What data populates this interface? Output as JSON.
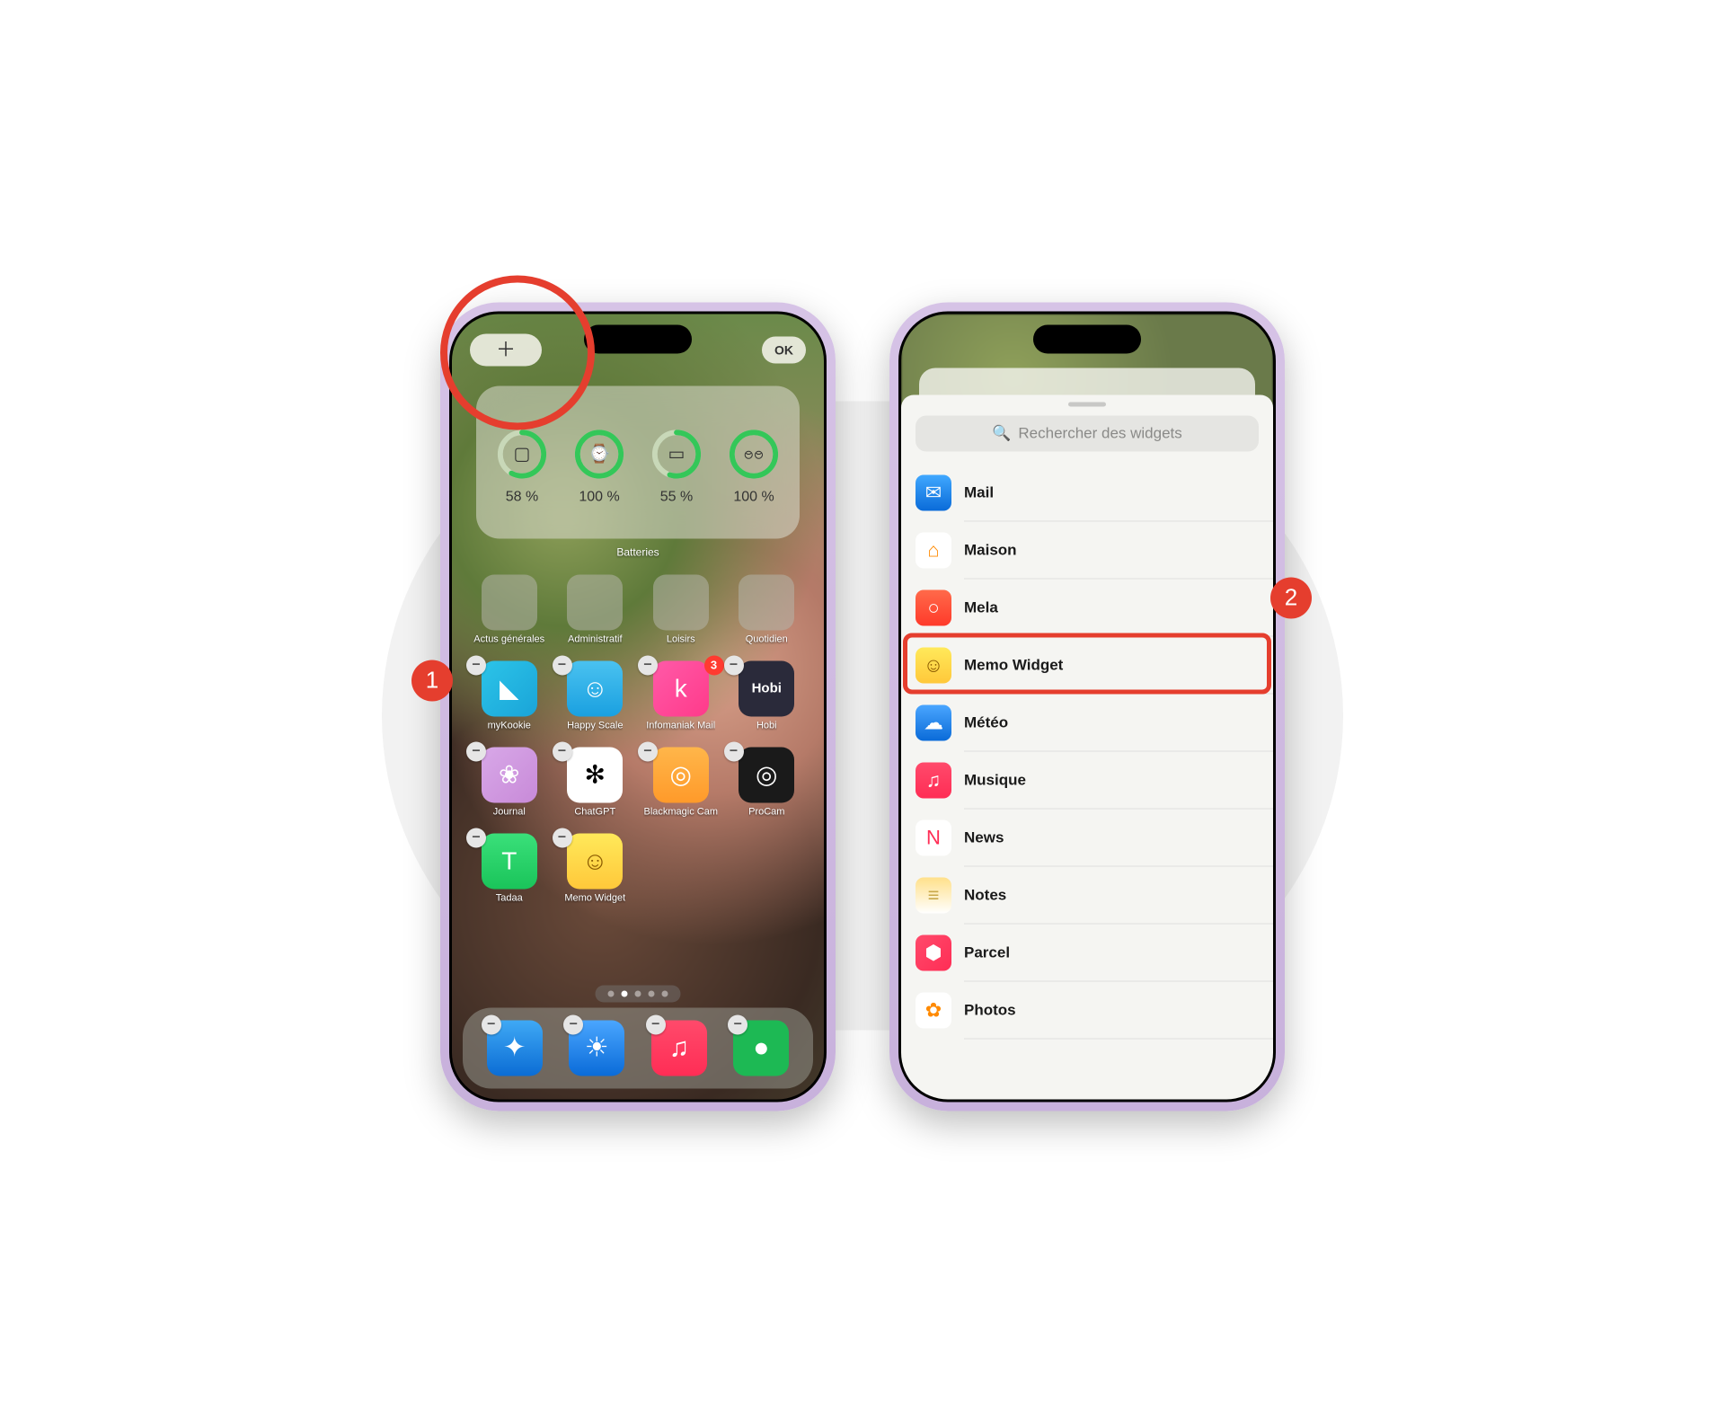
{
  "step_badges": {
    "one": "1",
    "two": "2"
  },
  "left": {
    "add_button": "＋",
    "done_button": "OK",
    "battery_widget": {
      "label": "Batteries",
      "items": [
        {
          "device": "phone",
          "glyph": "▢",
          "pct": "58 %",
          "fill": 0.58
        },
        {
          "device": "watch",
          "glyph": "⌚",
          "pct": "100 %",
          "fill": 1.0
        },
        {
          "device": "case",
          "glyph": "▭",
          "pct": "55 %",
          "fill": 0.55
        },
        {
          "device": "airpods",
          "glyph": "ႎႎ",
          "pct": "100 %",
          "fill": 1.0
        }
      ]
    },
    "folders": [
      {
        "label": "Actus générales"
      },
      {
        "label": "Administratif"
      },
      {
        "label": "Loisirs"
      },
      {
        "label": "Quotidien"
      }
    ],
    "apps": [
      {
        "label": "myKookie",
        "bg": "linear-gradient(135deg,#2cc4e8,#1aa4d8)",
        "glyph": "◣",
        "badge": null
      },
      {
        "label": "Happy Scale",
        "bg": "linear-gradient(180deg,#4ac2f0,#1aa0e0)",
        "glyph": "☺",
        "badge": null
      },
      {
        "label": "Infomaniak Mail",
        "bg": "linear-gradient(135deg,#ff5aa8,#ff3a8a)",
        "glyph": "k",
        "badge": "3"
      },
      {
        "label": "Hobi",
        "bg": "#2a2a3a",
        "glyph": "Hobi",
        "badge": null
      },
      {
        "label": "Journal",
        "bg": "linear-gradient(135deg,#d8a8e8,#c88ad8)",
        "glyph": "❀",
        "badge": null
      },
      {
        "label": "ChatGPT",
        "bg": "#ffffff",
        "glyph": "✻",
        "badge": null,
        "fg": "#000"
      },
      {
        "label": "Blackmagic Cam",
        "bg": "linear-gradient(180deg,#ffb64a,#ff9a2a)",
        "glyph": "◎",
        "badge": null
      },
      {
        "label": "ProCam",
        "bg": "#1a1a1a",
        "glyph": "◎",
        "badge": null
      },
      {
        "label": "Tadaa",
        "bg": "linear-gradient(180deg,#3ae07a,#1ac45a)",
        "glyph": "T",
        "badge": null
      },
      {
        "label": "Memo Widget",
        "bg": "linear-gradient(180deg,#ffe95a,#ffc83a)",
        "glyph": "☺",
        "badge": null,
        "fg": "#8a5a00"
      }
    ],
    "dock": [
      {
        "name": "safari",
        "bg": "ic-safari",
        "glyph": "✦"
      },
      {
        "name": "weather",
        "bg": "ic-weatherdock",
        "glyph": "☀"
      },
      {
        "name": "music",
        "bg": "ic-music",
        "glyph": "♫"
      },
      {
        "name": "spotify",
        "bg": "ic-spotify",
        "glyph": "●"
      }
    ]
  },
  "right": {
    "search_placeholder": "Rechercher des widgets",
    "widgets": [
      {
        "label": "Mail",
        "icon_bg": "linear-gradient(180deg,#40a8ff,#0a6bd8)",
        "glyph": "✉"
      },
      {
        "label": "Maison",
        "icon_bg": "#ffffff",
        "glyph": "⌂",
        "fg": "#ff8a00"
      },
      {
        "label": "Mela",
        "icon_bg": "linear-gradient(180deg,#ff6a4a,#ff3a2a)",
        "glyph": "○"
      },
      {
        "label": "Memo Widget",
        "icon_bg": "linear-gradient(180deg,#ffe95a,#ffc83a)",
        "glyph": "☺",
        "fg": "#8a5a00",
        "highlight": true
      },
      {
        "label": "Météo",
        "icon_bg": "linear-gradient(180deg,#4aa6ff,#0a6bd8)",
        "glyph": "☁"
      },
      {
        "label": "Musique",
        "icon_bg": "linear-gradient(180deg,#ff4a6b,#ff2d55)",
        "glyph": "♫"
      },
      {
        "label": "News",
        "icon_bg": "#ffffff",
        "glyph": "N",
        "fg": "#ff2d55"
      },
      {
        "label": "Notes",
        "icon_bg": "linear-gradient(180deg,#ffe08a,#ffffff)",
        "glyph": "≡",
        "fg": "#c8a84a"
      },
      {
        "label": "Parcel",
        "icon_bg": "linear-gradient(135deg,#ff4a6b,#ff2d55)",
        "glyph": "⬢"
      },
      {
        "label": "Photos",
        "icon_bg": "#ffffff",
        "glyph": "✿",
        "fg": "#ff8a00"
      }
    ]
  }
}
